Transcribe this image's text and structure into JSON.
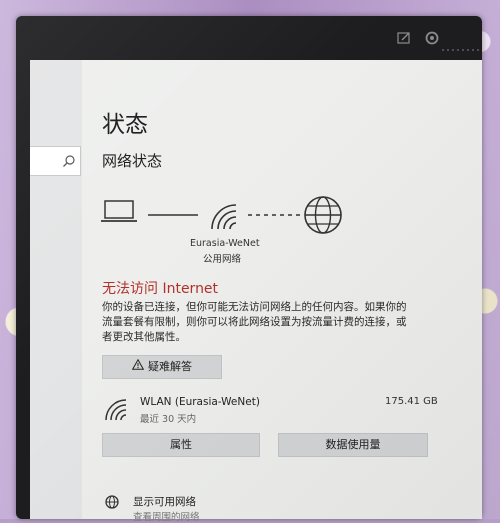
{
  "status_page": {
    "title": "状态",
    "section_title": "网络状态"
  },
  "network": {
    "name": "Eurasia-WeNet",
    "type": "公用网络"
  },
  "connection_status": {
    "title": "无法访问 Internet",
    "description_lines": [
      "你的设备已连接，但你可能无法访问网络上的任何内容。如果你的",
      "流量套餐有限制，则你可以将此网络设置为按流量计费的连接，或",
      "者更改其他属性。"
    ]
  },
  "troubleshoot_button": {
    "label": "疑难解答"
  },
  "connection": {
    "name": "WLAN (Eurasia-WeNet)",
    "period": "最近 30 天内",
    "data_used": "175.41 GB"
  },
  "properties_button": {
    "label": "属性"
  },
  "data_usage_button": {
    "label": "数据使用量"
  },
  "available_networks": {
    "title": "显示可用网络",
    "subtitle": "查看周围的网络"
  },
  "colors": {
    "error_red": "#b1312a",
    "button_gray": "#d3d5d6",
    "page_bg": "#eeefed"
  },
  "icons": {
    "search": "search-icon",
    "laptop": "laptop-icon",
    "wifi": "wifi-icon",
    "globe": "globe-icon",
    "warning": "warning-icon",
    "available": "available-networks-icon"
  }
}
